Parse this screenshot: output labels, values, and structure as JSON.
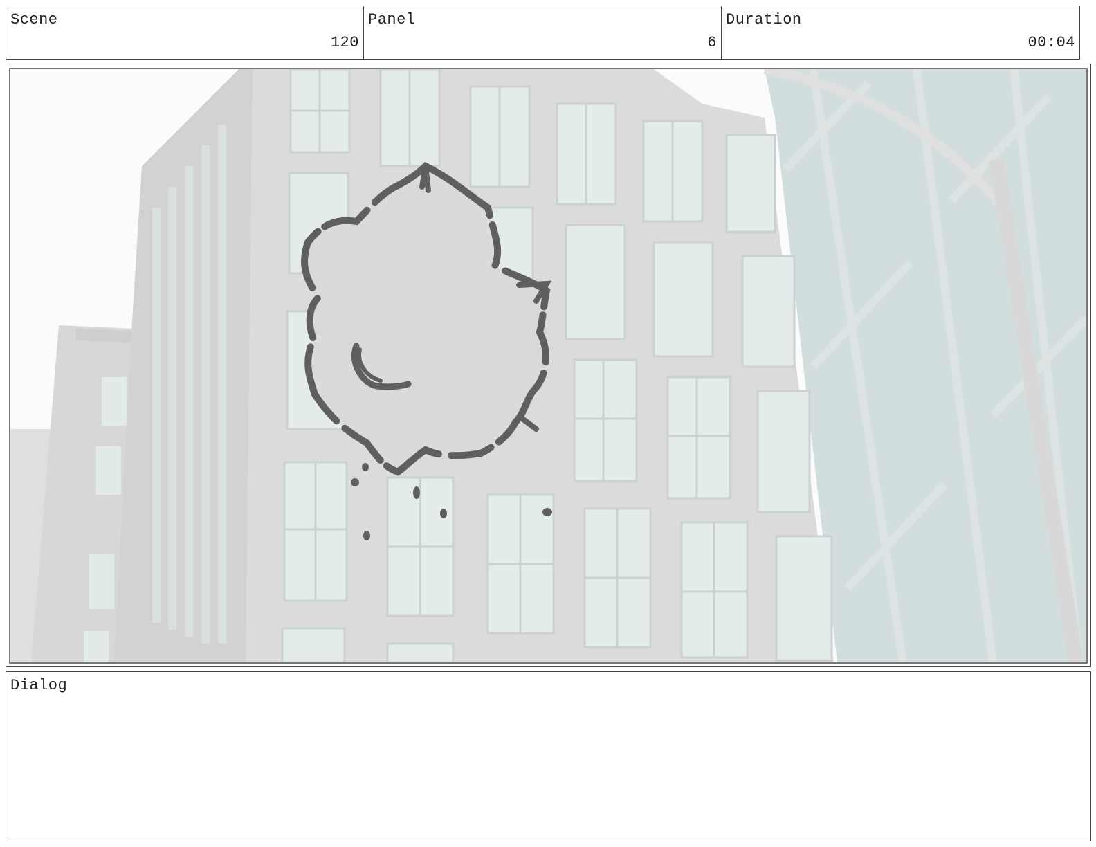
{
  "header": {
    "scene": {
      "label": "Scene",
      "value": "120"
    },
    "panel": {
      "label": "Panel",
      "value": "6"
    },
    "duration": {
      "label": "Duration",
      "value": "00:04"
    }
  },
  "dialog": {
    "label": "Dialog",
    "text": ""
  },
  "colors": {
    "border": "#444444",
    "building": "#d4d4d4",
    "window": "#dde6e6",
    "glass_tower": "#c9d6d6",
    "sketch": "#5f5f5f"
  },
  "icons": {
    "smoke_cloud": "smoke-cloud-sketch"
  }
}
